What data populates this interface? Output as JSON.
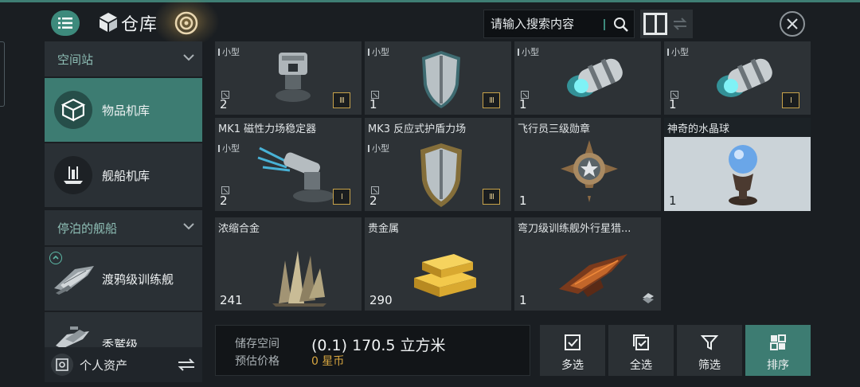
{
  "header": {
    "title": "仓库",
    "search_placeholder": "请输入搜索内容"
  },
  "sidebar": {
    "sections": [
      {
        "label": "空间站"
      },
      {
        "label": "停泊的舰船"
      }
    ],
    "items": [
      {
        "label": "物品机库",
        "active": true
      },
      {
        "label": "舰船机库",
        "active": false
      },
      {
        "label": "渡鸦级训练舰",
        "active": false
      },
      {
        "label": "秃鹫级",
        "active": false
      }
    ],
    "bottom_label": "个人资产"
  },
  "items": [
    {
      "name": "",
      "size": "小型",
      "qty": "2",
      "tier": "III",
      "icon": "turret"
    },
    {
      "name": "",
      "size": "小型",
      "qty": "1",
      "tier": "III",
      "icon": "shield-blue"
    },
    {
      "name": "",
      "size": "小型",
      "qty": "1",
      "tier": "",
      "icon": "capacitor"
    },
    {
      "name": "",
      "size": "小型",
      "qty": "1",
      "tier": "I",
      "icon": "capacitor"
    },
    {
      "name": "MK1 磁性力场稳定器",
      "size": "小型",
      "qty": "2",
      "tier": "I",
      "icon": "stabilizer"
    },
    {
      "name": "MK3 反应式护盾力场",
      "size": "小型",
      "qty": "2",
      "tier": "III",
      "icon": "shield-gold"
    },
    {
      "name": "飞行员三级勋章",
      "size": "",
      "qty": "1",
      "tier": "",
      "icon": "medal"
    },
    {
      "name": "神奇的水晶球",
      "size": "",
      "qty": "1",
      "tier": "",
      "icon": "crystal-ball"
    },
    {
      "name": "浓缩合金",
      "size": "",
      "qty": "241",
      "tier": "",
      "icon": "alloy"
    },
    {
      "name": "贵金属",
      "size": "",
      "qty": "290",
      "tier": "",
      "icon": "gold-bars"
    },
    {
      "name": "弯刀级训练舰外行星猎...",
      "size": "",
      "qty": "1",
      "tier": "",
      "icon": "ship-skin"
    }
  ],
  "storage": {
    "space_label": "储存空间",
    "space_value": "(0.1) 170.5 立方米",
    "price_label": "预估价格",
    "price_value": "0 星币"
  },
  "actions": [
    {
      "label": "多选",
      "icon": "multi-select-icon"
    },
    {
      "label": "全选",
      "icon": "select-all-icon"
    },
    {
      "label": "筛选",
      "icon": "filter-icon"
    },
    {
      "label": "排序",
      "icon": "sort-icon"
    }
  ],
  "colors": {
    "accent": "#3d7c72",
    "tier_border": "#c7a24a",
    "price": "#d7a640"
  }
}
